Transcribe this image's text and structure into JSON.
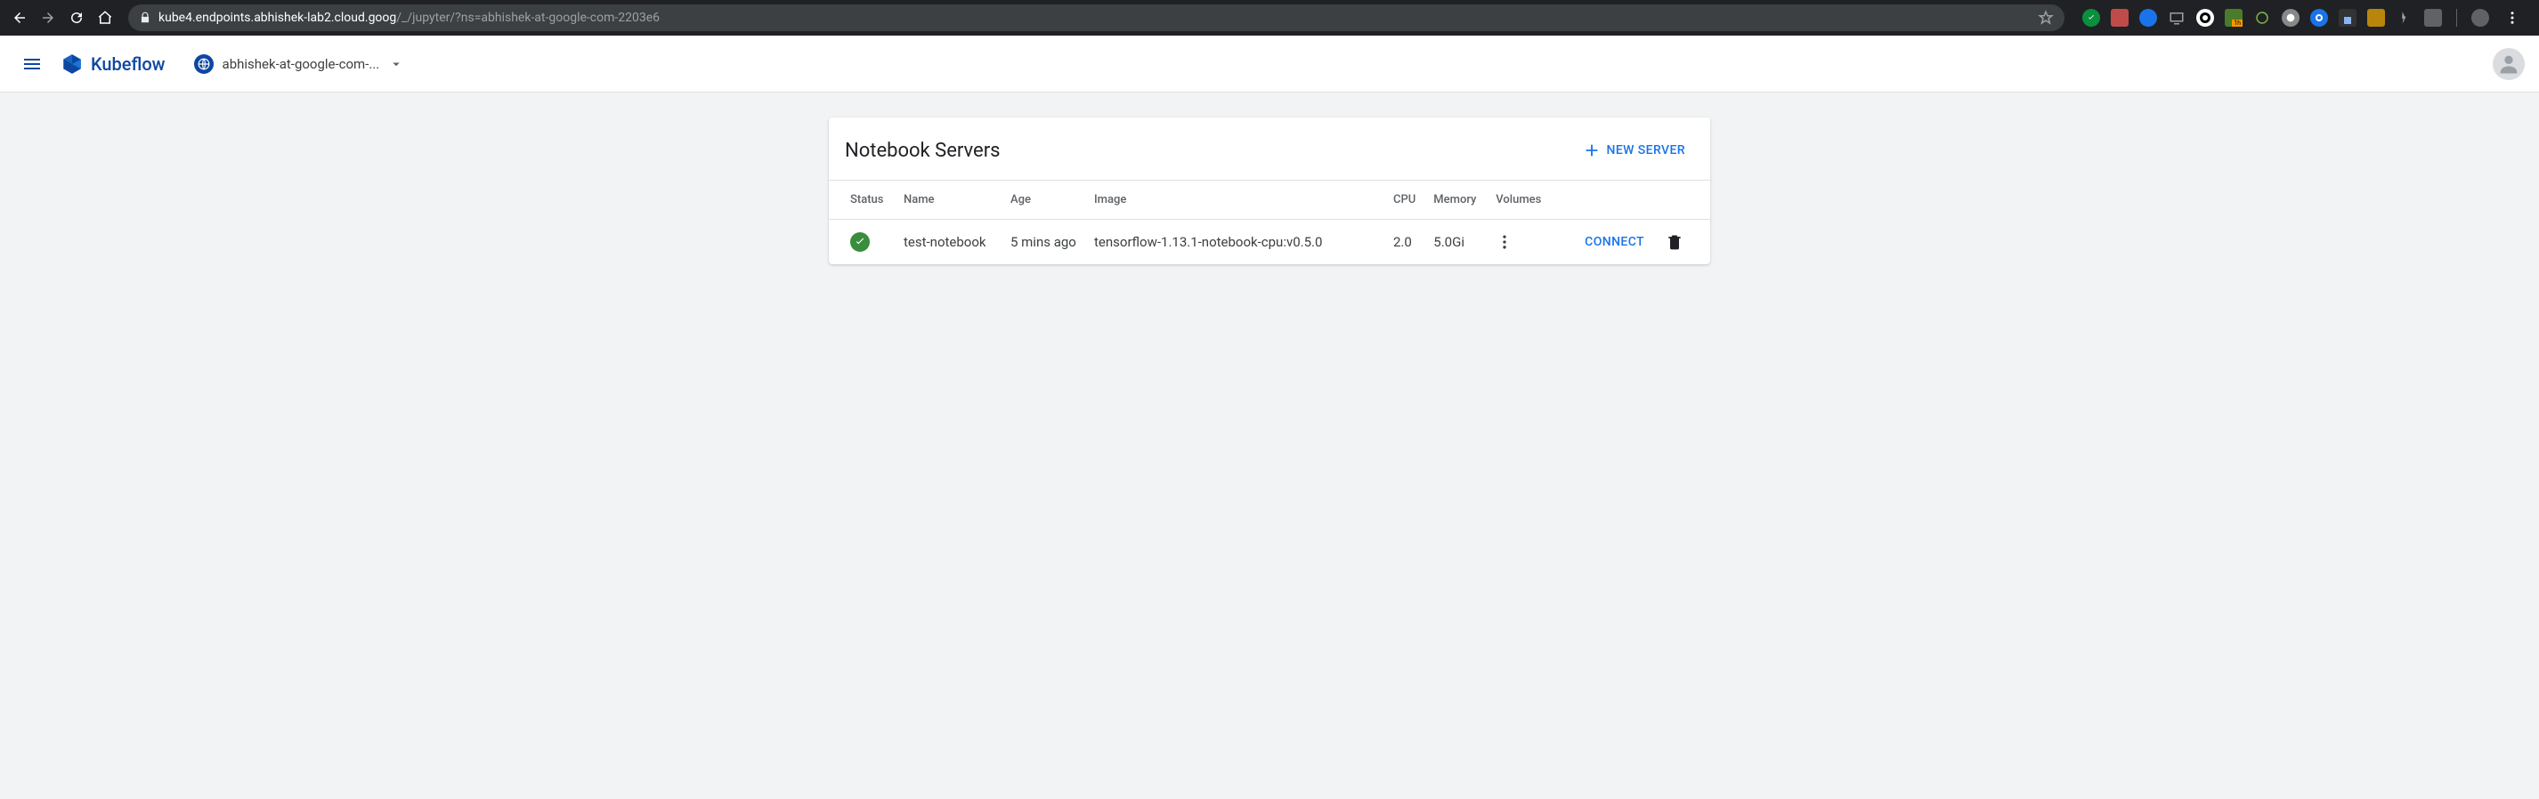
{
  "browser": {
    "url_host": "kube4.endpoints.abhishek-lab2.cloud.goog",
    "url_rest": "/_/jupyter/?ns=abhishek-at-google-com-2203e6"
  },
  "app": {
    "brand": "Kubeflow",
    "namespace": "abhishek-at-google-com-..."
  },
  "card": {
    "title": "Notebook Servers",
    "new_server_label": "NEW SERVER"
  },
  "columns": {
    "status": "Status",
    "name": "Name",
    "age": "Age",
    "image": "Image",
    "cpu": "CPU",
    "memory": "Memory",
    "volumes": "Volumes"
  },
  "row": {
    "name": "test-notebook",
    "age": "5 mins ago",
    "image": "tensorflow-1.13.1-notebook-cpu:v0.5.0",
    "cpu": "2.0",
    "memory": "5.0Gi",
    "connect_label": "CONNECT"
  }
}
